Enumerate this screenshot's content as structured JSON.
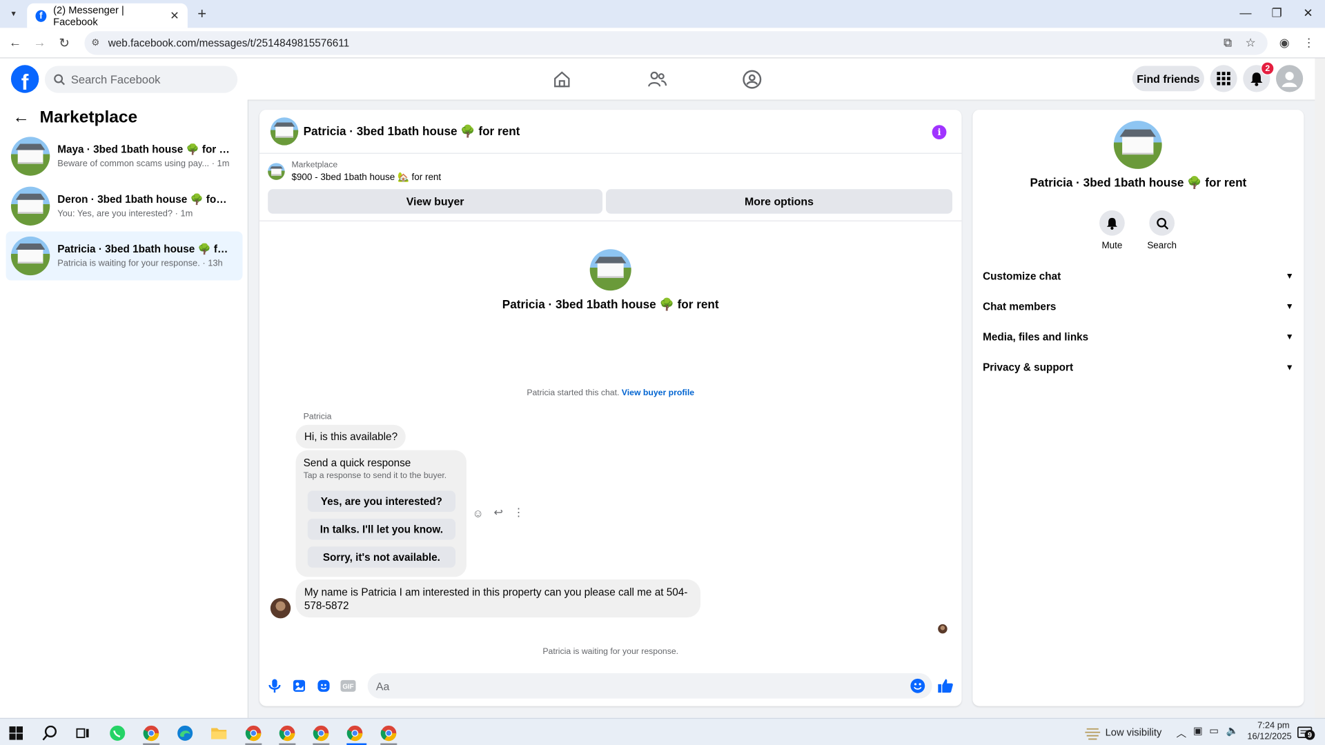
{
  "browser": {
    "tab_title": "(2) Messenger | Facebook",
    "url": "web.facebook.com/messages/t/2514849815576611"
  },
  "fb": {
    "search_placeholder": "Search Facebook",
    "find_friends": "Find friends",
    "notif_count": "2",
    "brand_color": "#0866ff"
  },
  "left": {
    "title": "Marketplace",
    "conversations": [
      {
        "title": "Maya · 3bed 1bath house 🌳 for rent",
        "snippet": "Beware of common scams using pay...",
        "time": " · 1m"
      },
      {
        "title": "Deron · 3bed 1bath house 🌳 for r...",
        "snippet": "You: Yes, are you interested?",
        "time": " · 1m"
      },
      {
        "title": "Patricia · 3bed 1bath house 🌳 for ...",
        "snippet": "Patricia is waiting for your response.",
        "time": " · 13h"
      }
    ]
  },
  "chat": {
    "header_title": "Patricia · 3bed 1bath house 🌳 for rent",
    "listing_source": "Marketplace",
    "listing_price": "$900 - 3bed 1bath house 🏡 for rent",
    "view_buyer": "View buyer",
    "more_options": "More options",
    "center_title": "Patricia · 3bed 1bath house 🌳 for rent",
    "started_text": "Patricia started this chat.",
    "view_buyer_profile": "View buyer profile",
    "sender_name": "Patricia",
    "first_message": "Hi, is this available?",
    "quick_title": "Send a quick response",
    "quick_sub": "Tap a response to send it to the buyer.",
    "quick_responses": [
      "Yes, are you interested?",
      "In talks. I'll let you know.",
      "Sorry, it's not available."
    ],
    "long_message_line1": "My name is Patricia I am interested in this property can you please call me at 504-",
    "long_message_line2": "578-5872",
    "waiting": "Patricia is waiting for your response.",
    "composer_placeholder": "Aa"
  },
  "right": {
    "title": "Patricia · 3bed 1bath house 🌳 for rent",
    "mute": "Mute",
    "search": "Search",
    "sections": [
      "Customize chat",
      "Chat members",
      "Media, files and links",
      "Privacy & support"
    ]
  },
  "taskbar": {
    "weather": "Low visibility",
    "time": "7:24 pm",
    "date": "16/12/2025",
    "notif_count": "9"
  }
}
